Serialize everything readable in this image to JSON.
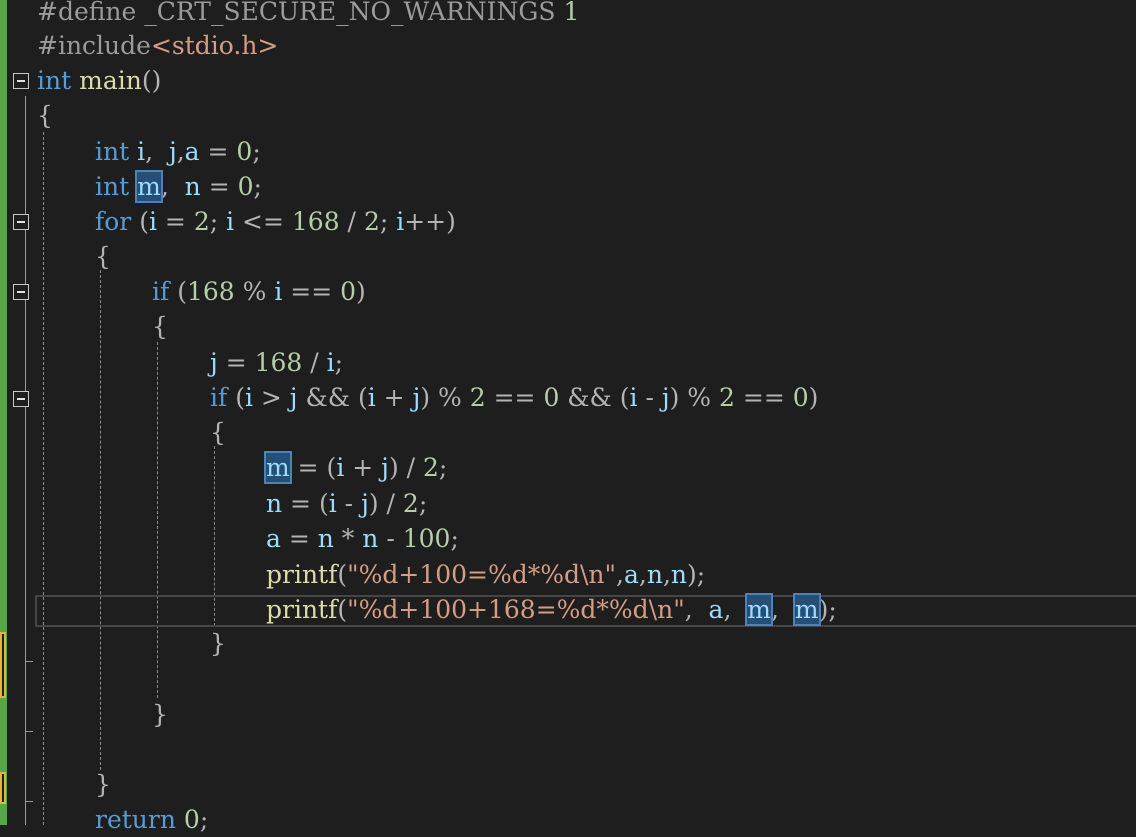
{
  "editor": {
    "lines": [
      {
        "tokens": [
          {
            "c": "pp",
            "t": "#define "
          },
          {
            "c": "pp",
            "t": "_CRT_SECURE_NO_WARNINGS"
          },
          {
            "c": "num",
            "t": " 1"
          }
        ]
      },
      {
        "tokens": [
          {
            "c": "pp",
            "t": "#include"
          },
          {
            "c": "str",
            "t": "<stdio.h>"
          }
        ]
      },
      {
        "tokens": [
          {
            "c": "kw",
            "t": "int"
          },
          {
            "c": "",
            "t": " "
          },
          {
            "c": "fn",
            "t": "main"
          },
          {
            "c": "op",
            "t": "()"
          }
        ]
      },
      {
        "tokens": [
          {
            "c": "op",
            "t": "{"
          }
        ]
      },
      {
        "tokens": [
          {
            "c": "kw",
            "t": "int"
          },
          {
            "c": "",
            "t": " "
          },
          {
            "c": "var",
            "t": "i"
          },
          {
            "c": "op",
            "t": ",  "
          },
          {
            "c": "var",
            "t": "j"
          },
          {
            "c": "op",
            "t": ","
          },
          {
            "c": "var",
            "t": "a"
          },
          {
            "c": "op",
            "t": " = "
          },
          {
            "c": "num",
            "t": "0"
          },
          {
            "c": "op",
            "t": ";"
          }
        ]
      },
      {
        "tokens": [
          {
            "c": "kw",
            "t": "int"
          },
          {
            "c": "",
            "t": " "
          },
          {
            "c": "var hl",
            "t": "m"
          },
          {
            "c": "op",
            "t": ",  "
          },
          {
            "c": "var",
            "t": "n"
          },
          {
            "c": "op",
            "t": " = "
          },
          {
            "c": "num",
            "t": "0"
          },
          {
            "c": "op",
            "t": ";"
          }
        ]
      },
      {
        "tokens": [
          {
            "c": "kw",
            "t": "for"
          },
          {
            "c": "op",
            "t": " ("
          },
          {
            "c": "var",
            "t": "i"
          },
          {
            "c": "op",
            "t": " = "
          },
          {
            "c": "num",
            "t": "2"
          },
          {
            "c": "op",
            "t": "; "
          },
          {
            "c": "var",
            "t": "i"
          },
          {
            "c": "op",
            "t": " <= "
          },
          {
            "c": "num",
            "t": "168"
          },
          {
            "c": "op",
            "t": " / "
          },
          {
            "c": "num",
            "t": "2"
          },
          {
            "c": "op",
            "t": "; "
          },
          {
            "c": "var",
            "t": "i"
          },
          {
            "c": "op",
            "t": "++)"
          }
        ]
      },
      {
        "tokens": [
          {
            "c": "op",
            "t": "{"
          }
        ]
      },
      {
        "tokens": [
          {
            "c": "kw",
            "t": "if"
          },
          {
            "c": "op",
            "t": " ("
          },
          {
            "c": "num",
            "t": "168"
          },
          {
            "c": "op",
            "t": " % "
          },
          {
            "c": "var",
            "t": "i"
          },
          {
            "c": "op",
            "t": " == "
          },
          {
            "c": "num",
            "t": "0"
          },
          {
            "c": "op",
            "t": ")"
          }
        ]
      },
      {
        "tokens": [
          {
            "c": "op",
            "t": "{"
          }
        ]
      },
      {
        "tokens": [
          {
            "c": "var",
            "t": "j"
          },
          {
            "c": "op",
            "t": " = "
          },
          {
            "c": "num",
            "t": "168"
          },
          {
            "c": "op",
            "t": " / "
          },
          {
            "c": "var",
            "t": "i"
          },
          {
            "c": "op",
            "t": ";"
          }
        ]
      },
      {
        "tokens": [
          {
            "c": "kw",
            "t": "if"
          },
          {
            "c": "op",
            "t": " ("
          },
          {
            "c": "var",
            "t": "i"
          },
          {
            "c": "op",
            "t": " > "
          },
          {
            "c": "var",
            "t": "j"
          },
          {
            "c": "op",
            "t": " && ("
          },
          {
            "c": "var",
            "t": "i"
          },
          {
            "c": "op",
            "t": " + "
          },
          {
            "c": "var",
            "t": "j"
          },
          {
            "c": "op",
            "t": ") % "
          },
          {
            "c": "num",
            "t": "2"
          },
          {
            "c": "op",
            "t": " == "
          },
          {
            "c": "num",
            "t": "0"
          },
          {
            "c": "op",
            "t": " && ("
          },
          {
            "c": "var",
            "t": "i"
          },
          {
            "c": "op",
            "t": " - "
          },
          {
            "c": "var",
            "t": "j"
          },
          {
            "c": "op",
            "t": ") % "
          },
          {
            "c": "num",
            "t": "2"
          },
          {
            "c": "op",
            "t": " == "
          },
          {
            "c": "num",
            "t": "0"
          },
          {
            "c": "op",
            "t": ")"
          }
        ]
      },
      {
        "tokens": [
          {
            "c": "op",
            "t": "{"
          }
        ]
      },
      {
        "tokens": [
          {
            "c": "var hl",
            "t": "m"
          },
          {
            "c": "op",
            "t": " = ("
          },
          {
            "c": "var",
            "t": "i"
          },
          {
            "c": "op",
            "t": " + "
          },
          {
            "c": "var",
            "t": "j"
          },
          {
            "c": "op",
            "t": ") / "
          },
          {
            "c": "num",
            "t": "2"
          },
          {
            "c": "op",
            "t": ";"
          }
        ]
      },
      {
        "tokens": [
          {
            "c": "var",
            "t": "n"
          },
          {
            "c": "op",
            "t": " = ("
          },
          {
            "c": "var",
            "t": "i"
          },
          {
            "c": "op",
            "t": " - "
          },
          {
            "c": "var",
            "t": "j"
          },
          {
            "c": "op",
            "t": ") / "
          },
          {
            "c": "num",
            "t": "2"
          },
          {
            "c": "op",
            "t": ";"
          }
        ]
      },
      {
        "tokens": [
          {
            "c": "var",
            "t": "a"
          },
          {
            "c": "op",
            "t": " = "
          },
          {
            "c": "var",
            "t": "n"
          },
          {
            "c": "op",
            "t": " * "
          },
          {
            "c": "var",
            "t": "n"
          },
          {
            "c": "op",
            "t": " - "
          },
          {
            "c": "num",
            "t": "100"
          },
          {
            "c": "op",
            "t": ";"
          }
        ]
      },
      {
        "tokens": [
          {
            "c": "fn",
            "t": "printf"
          },
          {
            "c": "op",
            "t": "("
          },
          {
            "c": "str",
            "t": "\"%d+100=%d*%d\\n\""
          },
          {
            "c": "op",
            "t": ","
          },
          {
            "c": "var",
            "t": "a"
          },
          {
            "c": "op",
            "t": ","
          },
          {
            "c": "var",
            "t": "n"
          },
          {
            "c": "op",
            "t": ","
          },
          {
            "c": "var",
            "t": "n"
          },
          {
            "c": "op",
            "t": ");"
          }
        ]
      },
      {
        "tokens": [
          {
            "c": "fn",
            "t": "printf"
          },
          {
            "c": "op",
            "t": "("
          },
          {
            "c": "str",
            "t": "\"%d+100+168=%d*%d\\n\""
          },
          {
            "c": "op",
            "t": ",  "
          },
          {
            "c": "var",
            "t": "a"
          },
          {
            "c": "op",
            "t": ",  "
          },
          {
            "c": "var hl",
            "t": "m"
          },
          {
            "c": "op",
            "t": ",  "
          },
          {
            "c": "var hl",
            "t": "m"
          },
          {
            "c": "op",
            "t": ");"
          }
        ]
      },
      {
        "tokens": [
          {
            "c": "op",
            "t": "}"
          }
        ]
      },
      {
        "tokens": []
      },
      {
        "tokens": [
          {
            "c": "op",
            "t": "}"
          }
        ]
      },
      {
        "tokens": []
      },
      {
        "tokens": [
          {
            "c": "op",
            "t": "}"
          }
        ]
      },
      {
        "tokens": [
          {
            "c": "kw",
            "t": "return"
          },
          {
            "c": "op",
            "t": " "
          },
          {
            "c": "num",
            "t": "0"
          },
          {
            "c": "op",
            "t": ";"
          }
        ]
      }
    ]
  },
  "colors": {
    "background": "#1e1e1e",
    "keyword": "#569cd6",
    "string": "#d69d85",
    "number": "#b5cea8",
    "function": "#dcdcaa",
    "variable": "#9cdcfe"
  }
}
